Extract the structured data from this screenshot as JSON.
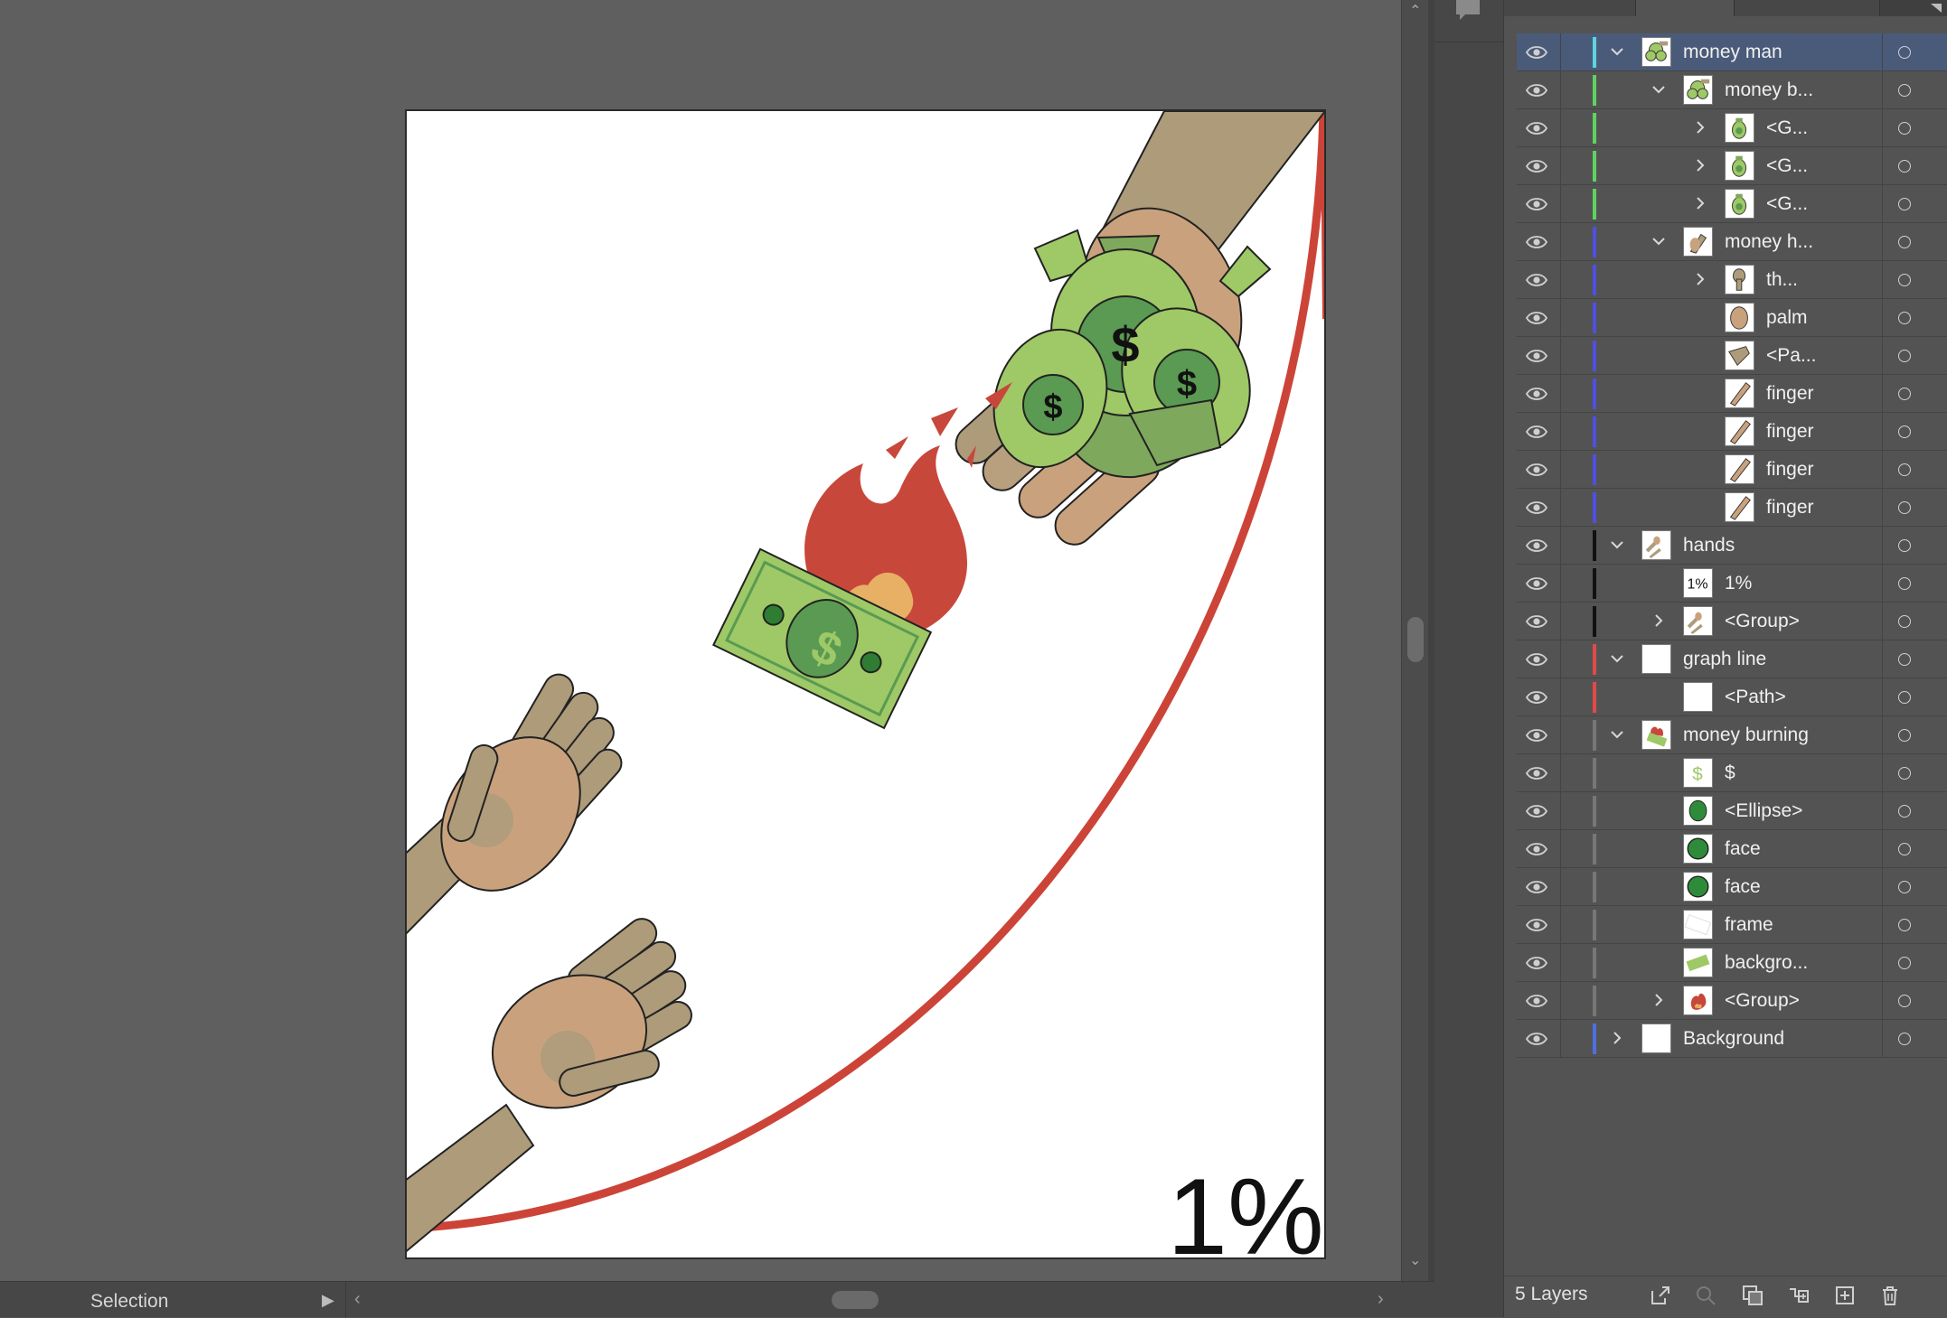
{
  "status_bar": {
    "tool": "Selection",
    "menu_arrow": "▶",
    "scroll_left": "‹",
    "scroll_right": "›"
  },
  "scrollbar": {
    "up": "⌃",
    "down": "⌄"
  },
  "artboard": {
    "text": "1%"
  },
  "layers_panel": {
    "layer_count": "5 Layers",
    "rows": [
      {
        "name": "money man",
        "depth": 0,
        "chevron": "open",
        "color": "#5fd3e0",
        "selected": true,
        "thumb": "money-bags"
      },
      {
        "name": "money b...",
        "depth": 1,
        "chevron": "open",
        "color": "#5fd35f",
        "thumb": "money-bags"
      },
      {
        "name": "<G...",
        "depth": 2,
        "chevron": "closed",
        "color": "#5fd35f",
        "thumb": "bag"
      },
      {
        "name": "<G...",
        "depth": 2,
        "chevron": "closed",
        "color": "#5fd35f",
        "thumb": "bag"
      },
      {
        "name": "<G...",
        "depth": 2,
        "chevron": "closed",
        "color": "#5fd35f",
        "thumb": "bag"
      },
      {
        "name": "money h...",
        "depth": 1,
        "chevron": "open",
        "color": "#4f4fe0",
        "thumb": "hand"
      },
      {
        "name": "th...",
        "depth": 2,
        "chevron": "closed",
        "color": "#4f4fe0",
        "thumb": "thumb"
      },
      {
        "name": "palm",
        "depth": 2,
        "chevron": "none",
        "color": "#4f4fe0",
        "thumb": "palm"
      },
      {
        "name": "<Pa...",
        "depth": 2,
        "chevron": "none",
        "color": "#4f4fe0",
        "thumb": "path"
      },
      {
        "name": "finger",
        "depth": 2,
        "chevron": "none",
        "color": "#4f4fe0",
        "thumb": "finger"
      },
      {
        "name": "finger",
        "depth": 2,
        "chevron": "none",
        "color": "#4f4fe0",
        "thumb": "finger"
      },
      {
        "name": "finger",
        "depth": 2,
        "chevron": "none",
        "color": "#4f4fe0",
        "thumb": "finger"
      },
      {
        "name": "finger",
        "depth": 2,
        "chevron": "none",
        "color": "#4f4fe0",
        "thumb": "finger"
      },
      {
        "name": "hands",
        "depth": 0,
        "chevron": "open",
        "color": "#111111",
        "thumb": "hands"
      },
      {
        "name": "1%",
        "depth": 1,
        "chevron": "none",
        "color": "#111111",
        "thumb": "text-1pct"
      },
      {
        "name": "<Group>",
        "depth": 1,
        "chevron": "closed",
        "color": "#111111",
        "thumb": "hands"
      },
      {
        "name": "graph line",
        "depth": 0,
        "chevron": "open",
        "color": "#e04a4a",
        "thumb": "blank"
      },
      {
        "name": "<Path>",
        "depth": 1,
        "chevron": "none",
        "color": "#e04a4a",
        "thumb": "blank"
      },
      {
        "name": "money burning",
        "depth": 0,
        "chevron": "open",
        "color": "#777777",
        "thumb": "burning"
      },
      {
        "name": "$",
        "depth": 1,
        "chevron": "none",
        "color": "#777777",
        "thumb": "dollar"
      },
      {
        "name": "<Ellipse>",
        "depth": 1,
        "chevron": "none",
        "color": "#777777",
        "thumb": "ellipse"
      },
      {
        "name": "face",
        "depth": 1,
        "chevron": "none",
        "color": "#777777",
        "thumb": "face"
      },
      {
        "name": "face",
        "depth": 1,
        "chevron": "none",
        "color": "#777777",
        "thumb": "face"
      },
      {
        "name": "frame",
        "depth": 1,
        "chevron": "none",
        "color": "#777777",
        "thumb": "frame"
      },
      {
        "name": "backgro...",
        "depth": 1,
        "chevron": "none",
        "color": "#777777",
        "thumb": "bill"
      },
      {
        "name": "<Group>",
        "depth": 1,
        "chevron": "closed",
        "color": "#777777",
        "thumb": "fire"
      },
      {
        "name": "Background",
        "depth": 0,
        "chevron": "closed",
        "color": "#4f6fe0",
        "thumb": "blank"
      }
    ]
  },
  "icons": {
    "eye": "eye-icon",
    "target": "target-circle-icon",
    "footer": [
      "export-icon",
      "search-icon",
      "clipping-mask-icon",
      "new-sublayer-icon",
      "new-layer-icon",
      "trash-icon"
    ]
  },
  "colors": {
    "graph_line": "#cc4438",
    "money_green": "#9ec966",
    "dark_green": "#5a9a52",
    "skin_light": "#c9a27d",
    "arm": "#ad9b7a",
    "fire": "#c8473b",
    "fire_inner": "#e7b065"
  }
}
